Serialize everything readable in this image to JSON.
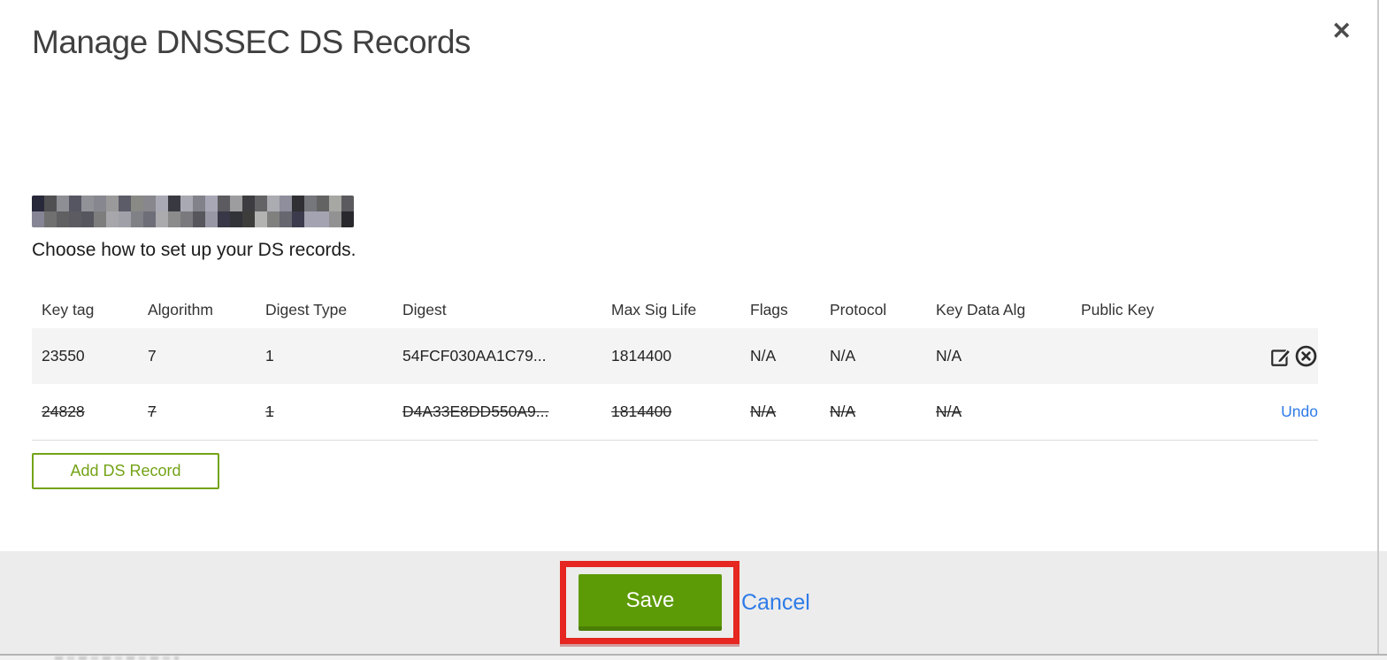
{
  "window": {
    "close_icon": "✕"
  },
  "dialog": {
    "title": "Manage DNSSEC DS Records",
    "subtitle": "Choose how to set up your DS records."
  },
  "table": {
    "columns": [
      "Key tag",
      "Algorithm",
      "Digest Type",
      "Digest",
      "Max Sig Life",
      "Flags",
      "Protocol",
      "Key Data Alg",
      "Public Key"
    ],
    "rows": [
      {
        "key_tag": "23550",
        "algorithm": "7",
        "digest_type": "1",
        "digest": "54FCF030AA1C79...",
        "max_sig_life": "1814400",
        "flags": "N/A",
        "protocol": "N/A",
        "key_data_alg": "N/A",
        "public_key": "",
        "state": "current",
        "action_icons": [
          "edit-icon",
          "delete-icon"
        ]
      },
      {
        "key_tag": "24828",
        "algorithm": "7",
        "digest_type": "1",
        "digest": "D4A33E8DD550A9...",
        "max_sig_life": "1814400",
        "flags": "N/A",
        "protocol": "N/A",
        "key_data_alg": "N/A",
        "public_key": "",
        "state": "deleted",
        "undo_label": "Undo"
      }
    ]
  },
  "buttons": {
    "add_ds_record": "Add DS Record",
    "save": "Save",
    "cancel": "Cancel"
  },
  "colors": {
    "green_button": "#5d9b06",
    "green_outline": "#74a317",
    "link_blue": "#2e7be8",
    "annotation_red": "#e52621",
    "footer_bg": "#ececec",
    "row_shaded_bg": "#f4f4f4"
  }
}
